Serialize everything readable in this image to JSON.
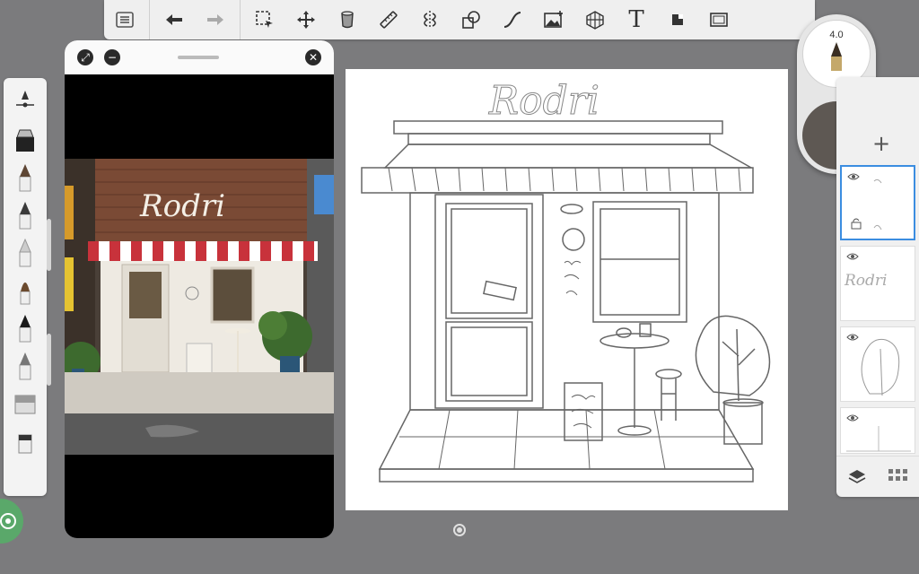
{
  "toolbar": {
    "tools": [
      "menu-icon",
      "undo-icon",
      "redo-icon",
      "selection-icon",
      "transform-icon",
      "fill-icon",
      "ruler-icon",
      "symmetry-icon",
      "shape-icon",
      "curve-icon",
      "add-image-icon",
      "perspective-icon",
      "text-icon",
      "canvas-icon",
      "fullscreen-icon"
    ],
    "text_tool_label": "T"
  },
  "reference_window": {
    "sign_text": "Rodri"
  },
  "canvas": {
    "title_text": "Rodri"
  },
  "color_puck": {
    "brush_size": "4.0",
    "primary_color": "#5e5853",
    "secondary_color": "#5e5853"
  },
  "layers": {
    "add_label": "+",
    "items": [
      {
        "name": "layer-1",
        "thumb_text": "",
        "active": true
      },
      {
        "name": "layer-2",
        "thumb_text": "Rodri",
        "active": false
      },
      {
        "name": "layer-3",
        "thumb_text": "",
        "active": false
      },
      {
        "name": "layer-4",
        "thumb_text": "",
        "active": false
      }
    ]
  },
  "colors": {
    "app_background": "#7b7b7d",
    "panel": "#efefef",
    "active_layer_border": "#3b8de0",
    "awning_red": "#c8323b"
  }
}
